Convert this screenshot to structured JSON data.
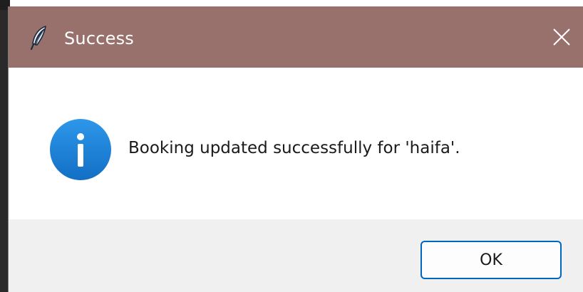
{
  "dialog": {
    "title": "Success",
    "app_icon": "feather-icon",
    "close_icon": "close-icon",
    "message_icon": "info-icon",
    "message": "Booking updated successfully for 'haifa'.",
    "ok_label": "OK"
  },
  "colors": {
    "titlebar": "#98706c",
    "info_blue": "#1f86dc",
    "button_border": "#0067c0",
    "footer": "#f0f0f0"
  }
}
